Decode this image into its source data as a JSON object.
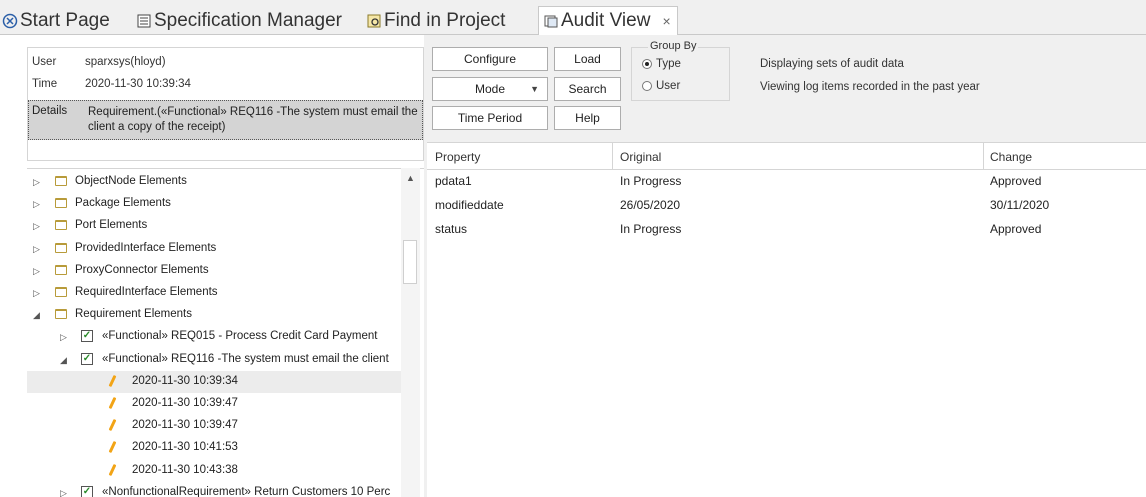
{
  "tabs": [
    {
      "label": "Start Page",
      "icon": "start-page-icon"
    },
    {
      "label": "Specification Manager",
      "icon": "specification-icon"
    },
    {
      "label": "Find in Project",
      "icon": "find-icon"
    },
    {
      "label": "Audit View",
      "icon": "audit-view-icon",
      "active": true,
      "close": "×"
    }
  ],
  "info": {
    "user_label": "User",
    "user_value": "sparxsys(hloyd)",
    "time_label": "Time",
    "time_value": "2020-11-30 10:39:34",
    "details_label": "Details",
    "details_value": "Requirement.(«Functional» REQ116 -The system must email the client a copy of the receipt)"
  },
  "toolbar": {
    "configure": "Configure",
    "load": "Load",
    "mode": "Mode",
    "search": "Search",
    "time_period": "Time Period",
    "help": "Help"
  },
  "group_by": {
    "legend": "Group By",
    "options": [
      {
        "label": "Type",
        "selected": true
      },
      {
        "label": "User",
        "selected": false
      }
    ]
  },
  "messages": [
    "Displaying sets of audit data",
    "Viewing log items recorded in the past year"
  ],
  "tree": {
    "items": [
      {
        "label": "ObjectNode Elements",
        "kind": "folder",
        "expanded": false,
        "level": 0
      },
      {
        "label": "Package Elements",
        "kind": "folder",
        "expanded": false,
        "level": 0
      },
      {
        "label": "Port Elements",
        "kind": "folder",
        "expanded": false,
        "level": 0
      },
      {
        "label": "ProvidedInterface Elements",
        "kind": "folder",
        "expanded": false,
        "level": 0
      },
      {
        "label": "ProxyConnector Elements",
        "kind": "folder",
        "expanded": false,
        "level": 0
      },
      {
        "label": "RequiredInterface Elements",
        "kind": "folder",
        "expanded": false,
        "level": 0
      },
      {
        "label": "Requirement Elements",
        "kind": "folder",
        "expanded": true,
        "level": 0
      },
      {
        "label": "«Functional» REQ015 - Process Credit Card Payment",
        "kind": "requirement",
        "expanded": false,
        "level": 1
      },
      {
        "label": "«Functional» REQ116 -The system must email the client",
        "kind": "requirement",
        "expanded": true,
        "level": 1
      },
      {
        "label": "2020-11-30 10:39:34",
        "kind": "entry",
        "level": 2,
        "selected": true
      },
      {
        "label": "2020-11-30 10:39:47",
        "kind": "entry",
        "level": 2
      },
      {
        "label": "2020-11-30 10:39:47",
        "kind": "entry",
        "level": 2
      },
      {
        "label": "2020-11-30 10:41:53",
        "kind": "entry",
        "level": 2
      },
      {
        "label": "2020-11-30 10:43:38",
        "kind": "entry",
        "level": 2
      },
      {
        "label": "«NonfunctionalRequirement» Return Customers 10 Perc",
        "kind": "requirement",
        "expanded": false,
        "level": 1
      }
    ]
  },
  "grid": {
    "columns": [
      "Property",
      "Original",
      "Change"
    ],
    "rows": [
      [
        "pdata1",
        "In Progress",
        "Approved"
      ],
      [
        "modifieddate",
        "26/05/2020",
        "30/11/2020"
      ],
      [
        "status",
        "In Progress",
        "Approved"
      ]
    ]
  },
  "colors": {
    "selection_gray": "#d4d4d4",
    "folder": "#b89b3a",
    "check_green": "#2a8a2a",
    "pencil": "#f2a416"
  }
}
